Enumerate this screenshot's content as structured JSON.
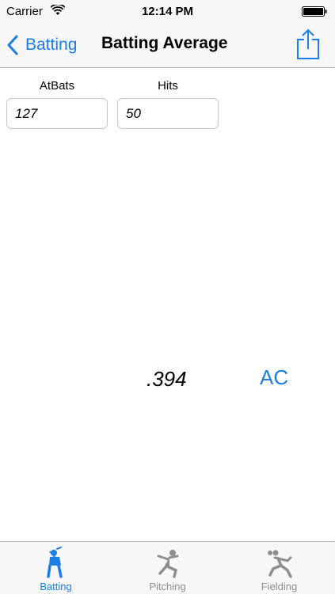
{
  "status_bar": {
    "carrier": "Carrier",
    "time": "12:14 PM",
    "wifi_icon": "wifi-icon",
    "battery_icon": "battery-icon"
  },
  "nav": {
    "back_label": "Batting",
    "title": "Batting Average",
    "back_icon": "chevron-left-icon",
    "share_icon": "share-icon"
  },
  "form": {
    "atbats_label": "AtBats",
    "atbats_value": "127",
    "hits_label": "Hits",
    "hits_value": "50"
  },
  "result": {
    "value": ".394",
    "clear_label": "AC"
  },
  "tabs": [
    {
      "label": "Batting",
      "icon": "batter-icon",
      "selected": true
    },
    {
      "label": "Pitching",
      "icon": "pitcher-icon",
      "selected": false
    },
    {
      "label": "Fielding",
      "icon": "fielder-icon",
      "selected": false
    }
  ],
  "colors": {
    "accent": "#1a7ee6",
    "inactive": "#8e8e8e",
    "bar_background": "#f7f7f7"
  }
}
